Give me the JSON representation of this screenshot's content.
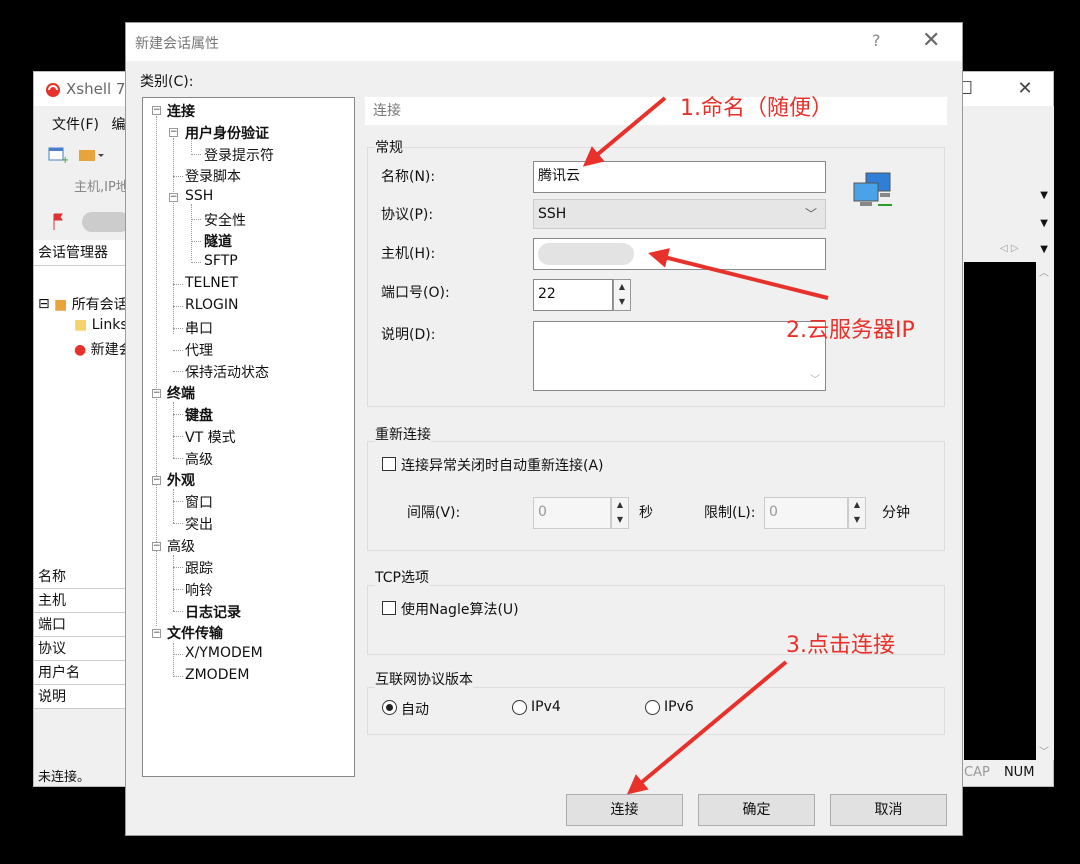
{
  "background_window": {
    "title": "Xshell 7",
    "menu_file": "文件(F)",
    "menu_edit": "编",
    "address_placeholder": "主机,IP地",
    "session_manager": "会话管理器",
    "tree": [
      "所有会话",
      "Links",
      "新建会"
    ],
    "props": [
      "名称",
      "主机",
      "端口",
      "协议",
      "用户名",
      "说明"
    ],
    "status": "未连接。",
    "caps": "CAP",
    "num": "NUM"
  },
  "dialog": {
    "title": "新建会话属性",
    "help": "?",
    "close": "✕",
    "category_label": "类别(C):",
    "tree": {
      "connection": "连接",
      "auth": "用户身份验证",
      "login_prompt": "登录提示符",
      "login_script": "登录脚本",
      "ssh": "SSH",
      "security": "安全性",
      "tunnel": "隧道",
      "sftp": "SFTP",
      "telnet": "TELNET",
      "rlogin": "RLOGIN",
      "serial": "串口",
      "proxy": "代理",
      "keepalive": "保持活动状态",
      "terminal": "终端",
      "keyboard": "键盘",
      "vt_mode": "VT 模式",
      "term_advanced": "高级",
      "appearance": "外观",
      "window": "窗口",
      "highlight": "突出",
      "advanced": "高级",
      "trace": "跟踪",
      "bell": "响铃",
      "logging": "日志记录",
      "file_transfer": "文件传输",
      "xymodem": "X/YMODEM",
      "zmodem": "ZMODEM"
    },
    "section_header": "连接",
    "general": {
      "title": "常规",
      "name_label": "名称(N):",
      "name_value": "腾讯云",
      "protocol_label": "协议(P):",
      "protocol_value": "SSH",
      "host_label": "主机(H):",
      "host_value": "",
      "port_label": "端口号(O):",
      "port_value": "22",
      "desc_label": "说明(D):",
      "desc_value": ""
    },
    "reconnect": {
      "title": "重新连接",
      "checkbox": "连接异常关闭时自动重新连接(A)",
      "interval_label": "间隔(V):",
      "interval_value": "0",
      "sec": "秒",
      "limit_label": "限制(L):",
      "limit_value": "0",
      "min": "分钟"
    },
    "tcp": {
      "title": "TCP选项",
      "nagle": "使用Nagle算法(U)"
    },
    "ip": {
      "title": "互联网协议版本",
      "auto": "自动",
      "ipv4": "IPv4",
      "ipv6": "IPv6",
      "selected": "auto"
    },
    "buttons": {
      "connect": "连接",
      "ok": "确定",
      "cancel": "取消"
    }
  },
  "annotations": {
    "step1": "1.命名（随便）",
    "step2": "2.云服务器IP",
    "step3": "3.点击连接",
    "color": "#e8312a"
  }
}
